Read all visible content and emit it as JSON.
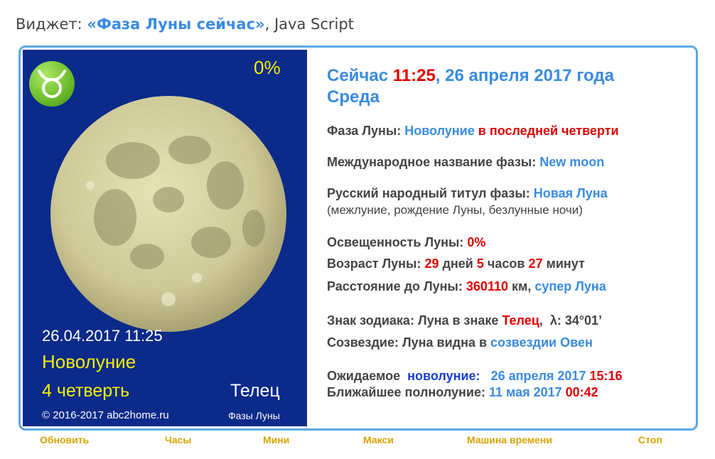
{
  "header": {
    "prefix": "Виджет:",
    "widget_name": "«Фаза Луны сейчас»",
    "suffix": ", Java Script"
  },
  "left": {
    "zodiac_icon": "taurus-icon",
    "illumination": "0%",
    "datetime": "26.04.2017 11:25",
    "phase": "Новолуние",
    "quarter": "4 четверть",
    "sign": "Телец",
    "copyright": "© 2016-2017 abc2home.ru",
    "phases_link": "Фазы Луны"
  },
  "right": {
    "now_label": "Сейчас",
    "time": "11:25",
    "date": ", 26 апреля 2017 года",
    "weekday": "Среда",
    "phase_label": "Фаза Луны:",
    "phase_value": "Новолуние",
    "phase_detail": "в последней четверти",
    "intl_label": "Международное название фазы:",
    "intl_value": "New moon",
    "rus_label": "Русский народный титул фазы:",
    "rus_value": "Новая Луна",
    "rus_note": "(межлуние, рождение Луны, безлунные ночи)",
    "illum_label": "Освещенность Луны:",
    "illum_value": "0%",
    "age_label": "Возраст Луны:",
    "age_days": "29",
    "age_days_word": "дней",
    "age_hours": "5",
    "age_hours_word": "часов",
    "age_minutes": "27",
    "age_minutes_word": "минут",
    "dist_label": "Расстояние до Луны:",
    "dist_value": "360110",
    "dist_unit": "км,",
    "dist_note": "супер Луна",
    "zodiac_label": "Знак зодиака: Луна в знаке",
    "zodiac_value": "Телец",
    "lambda": "λ: 34°01’",
    "constel_label": "Созвездие: Луна видна в",
    "constel_value": "созвездии Овен",
    "expected_label": "Ожидаемое",
    "expected_event": "новолуние:",
    "expected_date": "26 апреля 2017",
    "expected_time": "15:16",
    "full_label": "Ближайшее полнолуние:",
    "full_date": "11 мая 2017",
    "full_time": "00:42"
  },
  "footer": {
    "refresh": "Обновить",
    "clock": "Часы",
    "mini": "Мини",
    "maxi": "Макси",
    "time_machine": "Машина времени",
    "stop": "Стоп"
  },
  "colors": {
    "panel_bg": "#0b2a8a",
    "accent_blue": "#3a8be0",
    "accent_red": "#e00000",
    "accent_yellow": "#f4f000",
    "footer_gold": "#d6a400"
  }
}
